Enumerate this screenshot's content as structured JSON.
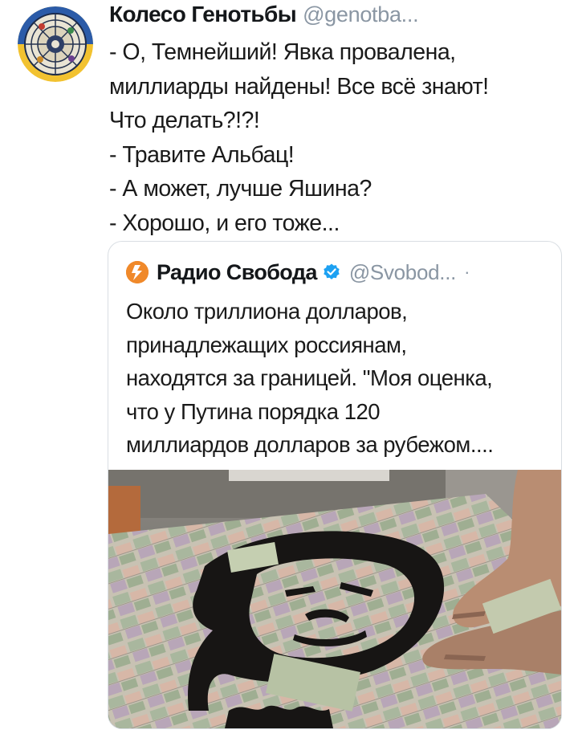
{
  "tweet": {
    "author_name": "Колесо Генотьбы",
    "author_handle": "@genotba...",
    "lines": [
      "- О, Темнейший! Явка провалена,",
      "миллиарды найдены! Все всё знают!",
      "Что делать?!?!",
      "- Травите Альбац!",
      "- А может, лучше Яшина?",
      "- Хорошо, и его тоже..."
    ]
  },
  "quote": {
    "author_name": "Радио Свобода",
    "author_handle": "@Svobod...",
    "separator": "·",
    "lines": [
      "Около триллиона долларов,",
      "принадлежащих россиянам,",
      "находятся за границей. \"Моя оценка,",
      "что у Путина порядка 120",
      "миллиардов долларов за рубежом...."
    ],
    "icons": {
      "verified": "verified-badge-icon",
      "avatar": "radio-svoboda-logo"
    },
    "colors": {
      "verified": "#1da1f2",
      "avatar": "#f0892a"
    }
  },
  "colors": {
    "handle": "#8a96a3",
    "border": "#d9dee3",
    "text": "#1a1a1a"
  }
}
